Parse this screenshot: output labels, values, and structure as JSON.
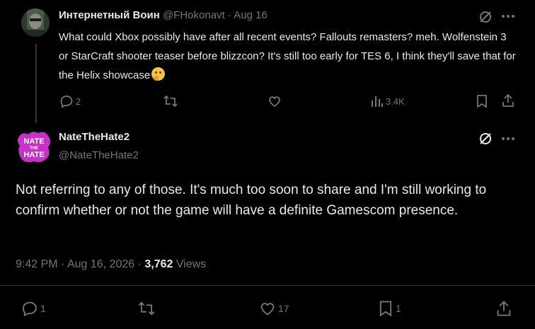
{
  "reply": {
    "author_name": "Интернетный Воин",
    "author_handle": "@FHokonavt",
    "separator": "·",
    "date": "Aug 16",
    "text": "What could Xbox possibly have after all recent events? Fallouts remasters? meh. Wolfenstein 3 or StarCraft shooter teaser before blizzcon? It's still too early for TES 6, I think they'll save that for the Helix showcase",
    "emoji": "thinking-face",
    "replies": "2",
    "reposts": "",
    "likes": "",
    "views": "3.4K"
  },
  "main": {
    "author_name": "NateTheHate2",
    "author_handle": "@NateTheHate2",
    "avatar_text": "NATE THE HATE",
    "text": "Not referring to any of those. It's much too soon to share and I'm still working to confirm whether or not the game will have a definite Gamescom presence.",
    "time": "9:42 PM",
    "separator": "·",
    "date": "Aug 16, 2026",
    "views_count": "3,762",
    "views_label": "Views",
    "replies": "1",
    "reposts": "",
    "likes": "17",
    "bookmarks": "1"
  },
  "colors": {
    "background": "#000000",
    "text_primary": "#e7e9ea",
    "text_muted": "#71767b",
    "divider": "#2f3336",
    "avatar_purple": "#c632c8"
  }
}
